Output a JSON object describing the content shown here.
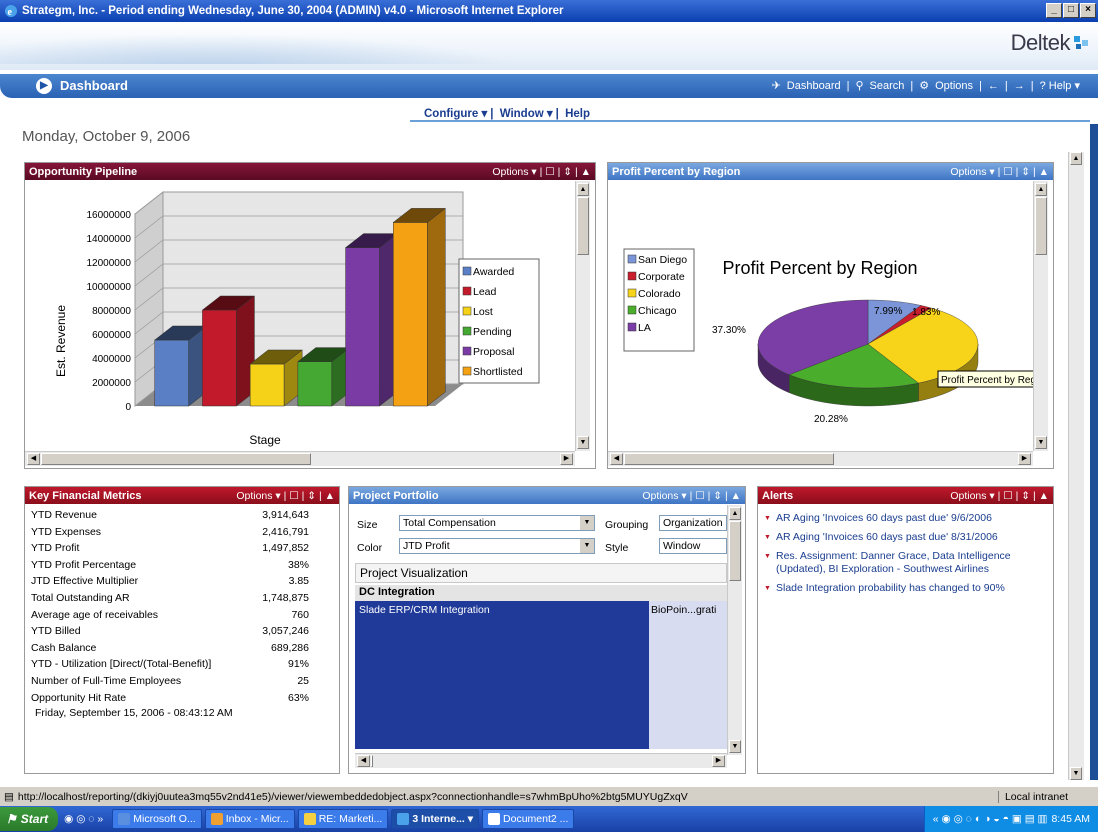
{
  "window": {
    "title": "Strategm, Inc. - Period ending Wednesday, June 30, 2004 (ADMIN) v4.0 - Microsoft Internet Explorer",
    "buttons": [
      "_",
      "□",
      "×"
    ]
  },
  "brand": {
    "logo_text": "Deltek"
  },
  "nav": {
    "dashboard_label": "Dashboard",
    "links": [
      "Dashboard",
      "Search",
      "Options",
      "←",
      "→",
      "? Help ▾"
    ]
  },
  "subnav": {
    "items": [
      "Configure ▾",
      "Window ▾",
      "Help"
    ]
  },
  "date_header": "Monday, October 9, 2006",
  "panel_options": "Options ▾ | ☐ | ⇕ | ▲",
  "opportunity": {
    "title": "Opportunity Pipeline",
    "ylabel": "Est. Revenue",
    "xlabel": "Stage",
    "yticks": [
      "16000000",
      "14000000",
      "12000000",
      "10000000",
      "8000000",
      "6000000",
      "4000000",
      "2000000",
      "0"
    ],
    "legend": [
      "Awarded",
      "Lead",
      "Lost",
      "Pending",
      "Proposal",
      "Shortlisted"
    ]
  },
  "profit": {
    "title": "Profit Percent by Region",
    "chart_title": "Profit Percent by Region",
    "legend": [
      "San Diego",
      "Corporate",
      "Colorado",
      "Chicago",
      "LA"
    ],
    "labels": [
      "7.99%",
      "1.83%",
      "37.30%",
      "20.28%"
    ],
    "tooltip": "Profit Percent by Region"
  },
  "chart_data": [
    {
      "type": "bar",
      "title": "Opportunity Pipeline",
      "xlabel": "Stage",
      "ylabel": "Est. Revenue",
      "ylim": [
        0,
        16000000
      ],
      "categories": [
        "Awarded",
        "Lead",
        "Lost",
        "Pending",
        "Proposal",
        "Shortlisted"
      ],
      "values": [
        5500000,
        8000000,
        3500000,
        3700000,
        13200000,
        15300000
      ],
      "colors": [
        "#5b7fc4",
        "#c21a2a",
        "#f5d118",
        "#45a832",
        "#7a3ca4",
        "#f4a214"
      ]
    },
    {
      "type": "pie",
      "title": "Profit Percent by Region",
      "categories": [
        "San Diego",
        "Corporate",
        "Colorado",
        "Chicago",
        "LA"
      ],
      "values": [
        7.99,
        1.83,
        32.6,
        20.28,
        37.3
      ],
      "colors": [
        "#7b95d8",
        "#c81e2e",
        "#f7d41a",
        "#4aad2c",
        "#7b3ea6"
      ]
    }
  ],
  "metrics": {
    "title": "Key Financial Metrics",
    "rows": [
      {
        "label": "YTD Revenue",
        "value": "3,914,643"
      },
      {
        "label": "YTD Expenses",
        "value": "2,416,791"
      },
      {
        "label": "YTD Profit",
        "value": "1,497,852"
      },
      {
        "label": "YTD Profit Percentage",
        "value": "38%"
      },
      {
        "label": "JTD Effective Multiplier",
        "value": "3.85"
      },
      {
        "label": "Total Outstanding AR",
        "value": "1,748,875"
      },
      {
        "label": "Average age of receivables",
        "value": "760"
      },
      {
        "label": "YTD Billed",
        "value": "3,057,246"
      },
      {
        "label": "Cash Balance",
        "value": "689,286"
      },
      {
        "label": "YTD - Utilization [Direct/(Total-Benefit)]",
        "value": "91%"
      },
      {
        "label": "Number of Full-Time Employees",
        "value": "25"
      },
      {
        "label": "Opportunity Hit Rate",
        "value": "63%"
      }
    ],
    "timestamp": "Friday, September 15, 2006 - 08:43:12 AM"
  },
  "portfolio": {
    "title": "Project Portfolio",
    "size_label": "Size",
    "size_value": "Total Compensation",
    "color_label": "Color",
    "color_value": "JTD Profit",
    "grouping_label": "Grouping",
    "grouping_value": "Organization",
    "style_label": "Style",
    "style_value": "Window",
    "viz_title": "Project Visualization",
    "group_title": "DC Integration",
    "item1": "Slade ERP/CRM Integration",
    "item2": "BioPoin...grati"
  },
  "alerts": {
    "title": "Alerts",
    "items": [
      "AR Aging 'Invoices 60 days past due' 9/6/2006",
      "AR Aging 'Invoices 60 days past due' 8/31/2006",
      "Res. Assignment: Danner Grace, Data Intelligence (Updated), BI Exploration - Southwest Airlines",
      "Slade Integration probability has changed to 90%"
    ]
  },
  "status": {
    "url": "http://localhost/reporting/(dkiyj0uutea3mq55v2nd41e5)/viewer/viewembeddedobject.aspx?connectionhandle=s7whmBpUho%2btg5MUYUgZxqV",
    "zone": "Local intranet"
  },
  "taskbar": {
    "start": "Start",
    "tasks": [
      "Microsoft O...",
      "Inbox - Micr...",
      "RE: Marketi...",
      "3 Interne... ▾",
      "Document2 ..."
    ],
    "time": "8:45 AM"
  }
}
